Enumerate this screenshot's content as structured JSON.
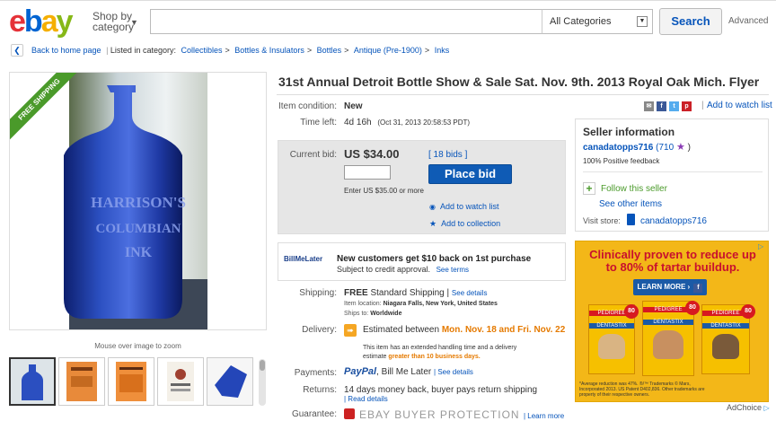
{
  "header": {
    "logo_letters": [
      "e",
      "b",
      "a",
      "y"
    ],
    "shop_by": "Shop by",
    "category": "category",
    "search_placeholder": "",
    "category_select": "All Categories",
    "search_button": "Search",
    "advanced": "Advanced"
  },
  "breadcrumb": {
    "back": "Back to home page",
    "listed_in": "Listed in category:",
    "items": [
      "Collectibles",
      "Bottles & Insulators",
      "Bottles",
      "Antique (Pre-1900)",
      "Inks"
    ]
  },
  "image": {
    "ribbon": "FREE SHIPPING",
    "mouse_over": "Mouse over image to zoom",
    "bottle_embossing": [
      "HARRISON'S",
      "COLUMBIAN",
      "INK"
    ]
  },
  "listing": {
    "title": "31st Annual Detroit Bottle Show & Sale Sat. Nov. 9th. 2013 Royal Oak Mich. Flyer",
    "item_condition_label": "Item condition:",
    "item_condition": "New",
    "time_left_label": "Time left:",
    "time_left": "4d 16h",
    "time_left_date": "(Oct 31, 2013  20:58:53 PDT)",
    "add_to_watch": "Add to watch list"
  },
  "bid": {
    "current_bid_label": "Current bid:",
    "current_bid": "US $34.00",
    "bids": "[ 18 bids ]",
    "enter_hint": "Enter US $35.00 or more",
    "place_bid": "Place bid",
    "add_watch": "Add to watch list",
    "add_collection": "Add to collection"
  },
  "billmelater": {
    "logo": "BillMeLater",
    "headline": "New customers get $10 back on 1st purchase",
    "sub": "Subject to credit approval.",
    "see_terms": "See terms"
  },
  "shipping": {
    "label": "Shipping:",
    "free": "FREE",
    "standard": "Standard Shipping |",
    "see_details": "See details",
    "item_location_label": "Item location:",
    "item_location": "Niagara Falls, New York, United States",
    "ships_to_label": "Ships to:",
    "ships_to": "Worldwide"
  },
  "delivery": {
    "label": "Delivery:",
    "estimated": "Estimated between",
    "dates": "Mon. Nov. 18 and Fri. Nov. 22",
    "note1": "This item has an extended handling time and a delivery",
    "note2": "estimate",
    "note_highlight": "greater than 10 business days."
  },
  "payments": {
    "label": "Payments:",
    "paypal": "PayPal",
    "bml": ", Bill Me Later",
    "see_details": "| See details"
  },
  "returns": {
    "label": "Returns:",
    "text": "14 days money back, buyer pays return shipping",
    "read_details": "| Read details"
  },
  "guarantee": {
    "label": "Guarantee:",
    "text": "EBAY BUYER PROTECTION",
    "learn": "| Learn more"
  },
  "seller": {
    "heading": "Seller information",
    "name": "canadatopps716",
    "feedback_count": "(710",
    "close_paren": ")",
    "positive": "100% Positive feedback",
    "follow": "Follow this seller",
    "see_other": "See other items",
    "visit_store_label": "Visit store:",
    "store_name": "canadatopps716"
  },
  "ad": {
    "headline": "Clinically proven to reduce up to 80% of tartar buildup.",
    "learn_more": "LEARN MORE ›",
    "brand": "PEDIGREE",
    "product": "DENTASTIX",
    "badge": "80",
    "fine_print": "*Average reduction was 47%. ®/™ Trademarks © Mars, Incorporated 2013. US Patent D402,836. Other trademarks are property of their respective owners.",
    "ad_choice": "AdChoice"
  },
  "colors": {
    "ebay_red": "#e53238",
    "ebay_blue": "#0064d2",
    "ebay_yellow": "#f5af02",
    "ebay_green": "#86b817",
    "link": "#0654ba",
    "place_bid": "#0f5bb5",
    "orange": "#e57a00"
  }
}
